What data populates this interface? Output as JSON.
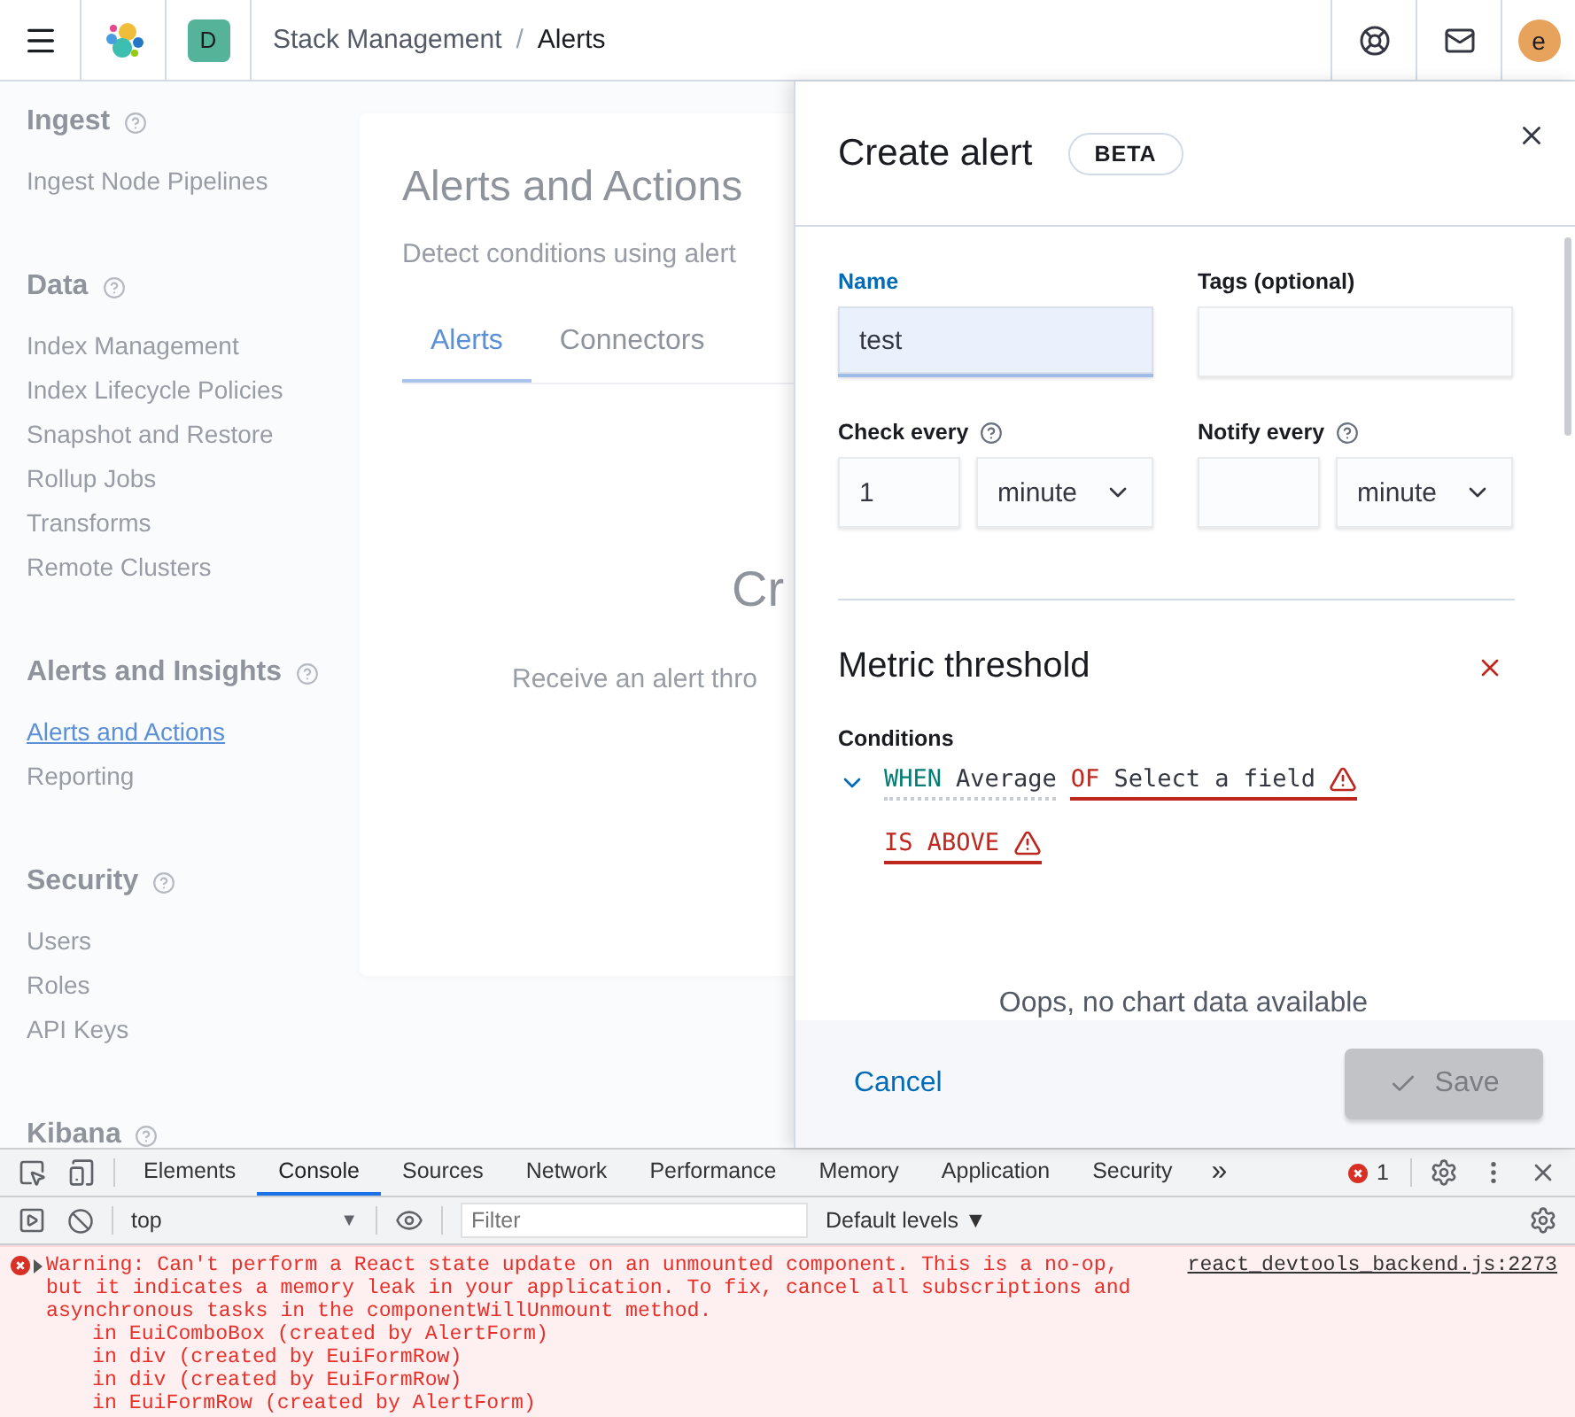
{
  "header": {
    "space_avatar": "D",
    "separator": "/",
    "breadcrumbs": [
      {
        "label": "Stack Management",
        "current": false
      },
      {
        "label": "Alerts",
        "current": true
      }
    ],
    "user_avatar": "e"
  },
  "sidebar": {
    "sections": [
      {
        "title": "Ingest",
        "items": [
          {
            "label": "Ingest Node Pipelines",
            "selected": false
          }
        ]
      },
      {
        "title": "Data",
        "items": [
          {
            "label": "Index Management",
            "selected": false
          },
          {
            "label": "Index Lifecycle Policies",
            "selected": false
          },
          {
            "label": "Snapshot and Restore",
            "selected": false
          },
          {
            "label": "Rollup Jobs",
            "selected": false
          },
          {
            "label": "Transforms",
            "selected": false
          },
          {
            "label": "Remote Clusters",
            "selected": false
          }
        ]
      },
      {
        "title": "Alerts and Insights",
        "items": [
          {
            "label": "Alerts and Actions",
            "selected": true
          },
          {
            "label": "Reporting",
            "selected": false
          }
        ]
      },
      {
        "title": "Security",
        "items": [
          {
            "label": "Users",
            "selected": false
          },
          {
            "label": "Roles",
            "selected": false
          },
          {
            "label": "API Keys",
            "selected": false
          }
        ]
      },
      {
        "title": "Kibana"
      }
    ]
  },
  "page": {
    "title": "Alerts and Actions",
    "description": "Detect conditions using alert",
    "tabs": [
      {
        "label": "Alerts",
        "selected": true
      },
      {
        "label": "Connectors",
        "selected": false
      }
    ],
    "empty_title": "Cr",
    "empty_body": "Receive an alert thro"
  },
  "flyout": {
    "title": "Create alert",
    "badge": "BETA",
    "name": {
      "label": "Name",
      "value": "test",
      "focused": true
    },
    "tags": {
      "label": "Tags (optional)",
      "focused": false
    },
    "check_every": {
      "label": "Check every",
      "value": "1",
      "unit": "minute"
    },
    "notify_every": {
      "label": "Notify every",
      "unit": "minute"
    },
    "alert_type": {
      "title": "Metric threshold",
      "conditions_label": "Conditions",
      "expressions": [
        {
          "keyword": "WHEN",
          "value": "Average",
          "invalid": false
        },
        {
          "keyword": "OF",
          "value": "Select a field",
          "invalid": true
        },
        {
          "keyword": "IS ABOVE",
          "invalid": true
        }
      ],
      "chart_message": "Oops, no chart data available"
    },
    "cancel": "Cancel",
    "save": {
      "label": "Save",
      "disabled": true
    }
  },
  "devtools": {
    "tabs": [
      {
        "label": "Elements",
        "selected": false
      },
      {
        "label": "Console",
        "selected": true
      },
      {
        "label": "Sources",
        "selected": false
      },
      {
        "label": "Network",
        "selected": false
      },
      {
        "label": "Performance",
        "selected": false
      },
      {
        "label": "Memory",
        "selected": false
      },
      {
        "label": "Application",
        "selected": false
      },
      {
        "label": "Security",
        "selected": false
      }
    ],
    "more": "»",
    "error_count": "1",
    "context": "top",
    "context_caret": "▼",
    "filter_placeholder": "Filter",
    "levels": "Default levels ▼",
    "messages": [
      {
        "text": "Warning: Can't perform a React state update on an unmounted component. This is a no-op, but it indicates a memory leak in your application. To fix, cancel all subscriptions and asynchronous tasks in the componentWillUnmount method.",
        "source": "react_devtools_backend.js:2273",
        "stack": [
          "in EuiComboBox (created by AlertForm)",
          "in div (created by EuiFormRow)",
          "in div (created by EuiFormRow)",
          "in EuiFormRow (created by AlertForm)"
        ]
      }
    ]
  }
}
